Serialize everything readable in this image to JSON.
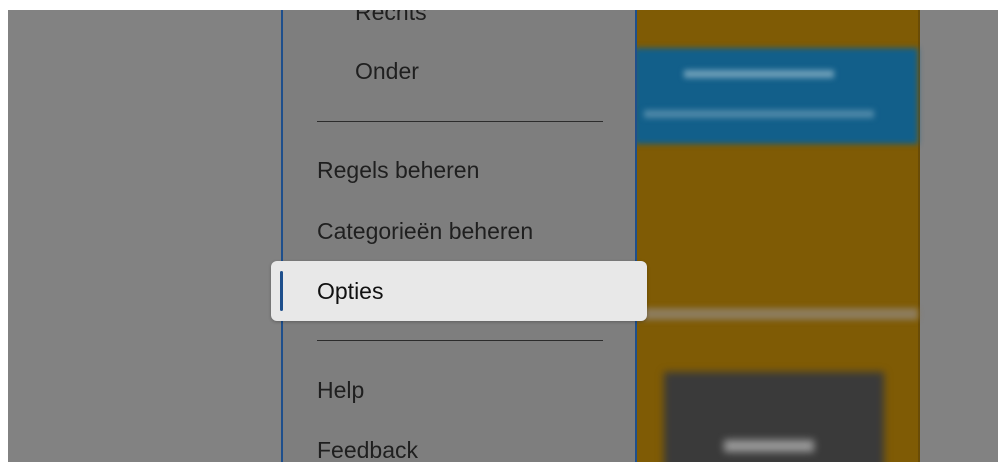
{
  "menu": {
    "items": [
      {
        "label": "Rechts"
      },
      {
        "label": "Onder"
      },
      {
        "label": "Regels beheren"
      },
      {
        "label": "Categorieën beheren"
      },
      {
        "label": "Opties"
      },
      {
        "label": "Help"
      },
      {
        "label": "Feedback"
      }
    ]
  },
  "colors": {
    "overlay": "#828282",
    "accent": "#1e4f8c",
    "highlight": "#e8e8e8",
    "background_panel": "#7f5b05"
  }
}
